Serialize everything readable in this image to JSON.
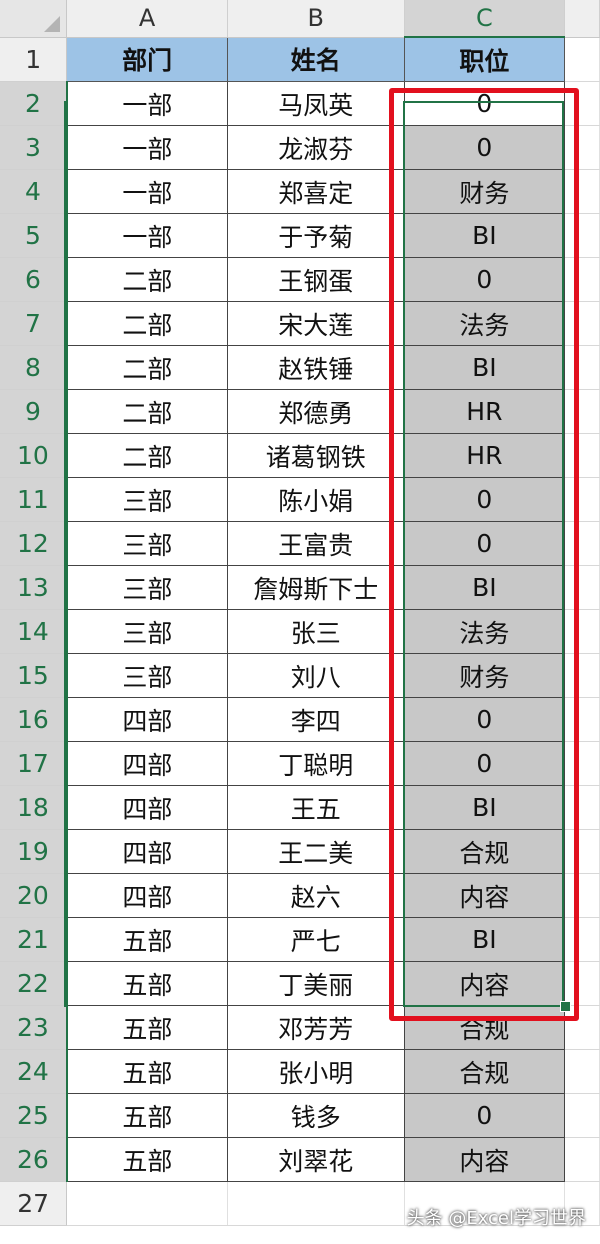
{
  "columns": [
    "A",
    "B",
    "C"
  ],
  "header_row_number": "1",
  "last_row_number": "27",
  "headers": [
    "部门",
    "姓名",
    "职位"
  ],
  "rows": [
    {
      "n": "2",
      "a": "一部",
      "b": "马凤英",
      "c": "0"
    },
    {
      "n": "3",
      "a": "一部",
      "b": "龙淑芬",
      "c": "0"
    },
    {
      "n": "4",
      "a": "一部",
      "b": "郑喜定",
      "c": "财务"
    },
    {
      "n": "5",
      "a": "一部",
      "b": "于予菊",
      "c": "BI"
    },
    {
      "n": "6",
      "a": "二部",
      "b": "王钢蛋",
      "c": "0"
    },
    {
      "n": "7",
      "a": "二部",
      "b": "宋大莲",
      "c": "法务"
    },
    {
      "n": "8",
      "a": "二部",
      "b": "赵铁锤",
      "c": "BI"
    },
    {
      "n": "9",
      "a": "二部",
      "b": "郑德勇",
      "c": "HR"
    },
    {
      "n": "10",
      "a": "二部",
      "b": "诸葛钢铁",
      "c": "HR"
    },
    {
      "n": "11",
      "a": "三部",
      "b": "陈小娟",
      "c": "0"
    },
    {
      "n": "12",
      "a": "三部",
      "b": "王富贵",
      "c": "0"
    },
    {
      "n": "13",
      "a": "三部",
      "b": "詹姆斯下士",
      "c": "BI"
    },
    {
      "n": "14",
      "a": "三部",
      "b": "张三",
      "c": "法务"
    },
    {
      "n": "15",
      "a": "三部",
      "b": "刘八",
      "c": "财务"
    },
    {
      "n": "16",
      "a": "四部",
      "b": "李四",
      "c": "0"
    },
    {
      "n": "17",
      "a": "四部",
      "b": "丁聪明",
      "c": "0"
    },
    {
      "n": "18",
      "a": "四部",
      "b": "王五",
      "c": "BI"
    },
    {
      "n": "19",
      "a": "四部",
      "b": "王二美",
      "c": "合规"
    },
    {
      "n": "20",
      "a": "四部",
      "b": "赵六",
      "c": "内容"
    },
    {
      "n": "21",
      "a": "五部",
      "b": "严七",
      "c": "BI"
    },
    {
      "n": "22",
      "a": "五部",
      "b": "丁美丽",
      "c": "内容"
    },
    {
      "n": "23",
      "a": "五部",
      "b": "邓芳芳",
      "c": "合规"
    },
    {
      "n": "24",
      "a": "五部",
      "b": "张小明",
      "c": "合规"
    },
    {
      "n": "25",
      "a": "五部",
      "b": "钱多",
      "c": "0"
    },
    {
      "n": "26",
      "a": "五部",
      "b": "刘翠花",
      "c": "内容"
    }
  ],
  "watermark": "头条 @Excel学习世界",
  "colors": {
    "header_fill": "#9dc3e6",
    "selected_fill": "#c8c8c8",
    "selection_border": "#217346",
    "highlight_box": "#e2101e"
  }
}
